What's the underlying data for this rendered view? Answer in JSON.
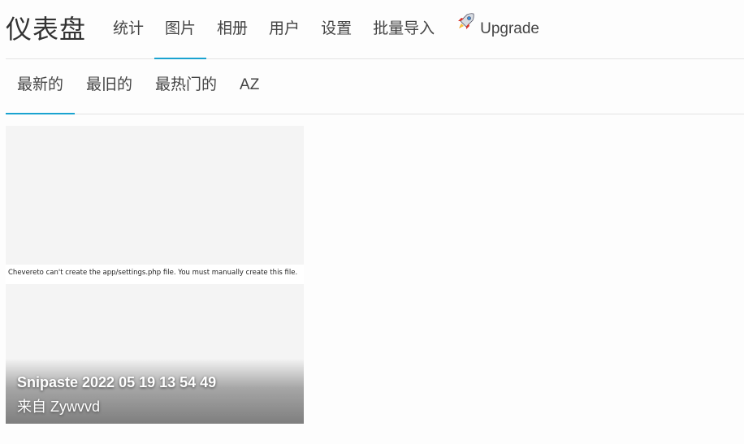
{
  "header": {
    "brand": "仪表盘",
    "nav": [
      {
        "label": "统计"
      },
      {
        "label": "图片",
        "active": true
      },
      {
        "label": "相册"
      },
      {
        "label": "用户"
      },
      {
        "label": "设置"
      },
      {
        "label": "批量导入"
      },
      {
        "label": "Upgrade",
        "icon": "rocket-icon"
      }
    ]
  },
  "sort": {
    "tabs": [
      {
        "label": "最新的",
        "active": true
      },
      {
        "label": "最旧的"
      },
      {
        "label": "最热门的"
      },
      {
        "label": "AZ"
      }
    ]
  },
  "gallery": {
    "items": [
      {
        "thumbnail_text": "Chevereto can't create the app/settings.php file. You must manually create this file.",
        "title": "Snipaste 2022 05 19 13 54 49",
        "author": "来自 Zywvvd"
      }
    ]
  },
  "colors": {
    "accent": "#1aa3d0",
    "divider": "#e3e3e3",
    "card_bg": "#f4f4f4"
  }
}
